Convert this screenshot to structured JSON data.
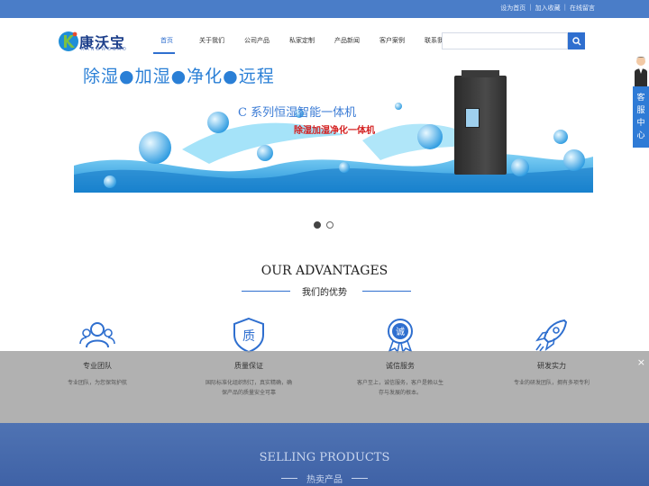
{
  "topbar": {
    "links": [
      "设为首页",
      "加入收藏",
      "在线留言"
    ],
    "separator": "|"
  },
  "logo": {
    "text_cn": "康沃宝",
    "text_en": "KANGWOBAO"
  },
  "nav": {
    "items": [
      "首页",
      "关于我们",
      "公司产品",
      "私家定制",
      "产品新闻",
      "客户案例",
      "联系我们"
    ],
    "active_index": 0
  },
  "search": {
    "placeholder": "",
    "button_icon": "search-icon"
  },
  "banner": {
    "headline": "除湿●加湿●净化●远程",
    "subtitle": "C 系列恒湿智能一体机",
    "subtitle2": "除湿加湿净化一体机",
    "slide_count": 2,
    "active_slide": 0
  },
  "advantages": {
    "title_en": "OUR ADVANTAGES",
    "title_cn": "我们的优势",
    "items": [
      {
        "icon": "team-icon",
        "name": "专业团队",
        "desc": "专业团队，为您保驾护航"
      },
      {
        "icon": "quality-icon",
        "name": "质量保证",
        "desc": "国际标准化组织制订，真实精确，确保产品的质量安全可靠"
      },
      {
        "icon": "integrity-icon",
        "name": "诚信服务",
        "desc": "客户至上，诚信服务，客户是赖以生存与发展的根本。"
      },
      {
        "icon": "rocket-icon",
        "name": "研发实力",
        "desc": "专业的研发团队，拥有多项专利"
      }
    ],
    "overlay_close": "×"
  },
  "selling": {
    "title_en": "SELLING PRODUCTS",
    "title_cn": "热卖产品"
  },
  "service": {
    "chars": [
      "客",
      "服",
      "中",
      "心"
    ]
  },
  "colors": {
    "brand_blue": "#2f6fcf",
    "topbar": "#4a7dc8",
    "selling_bg": "#4f73b3",
    "banner_red": "#d42020"
  }
}
